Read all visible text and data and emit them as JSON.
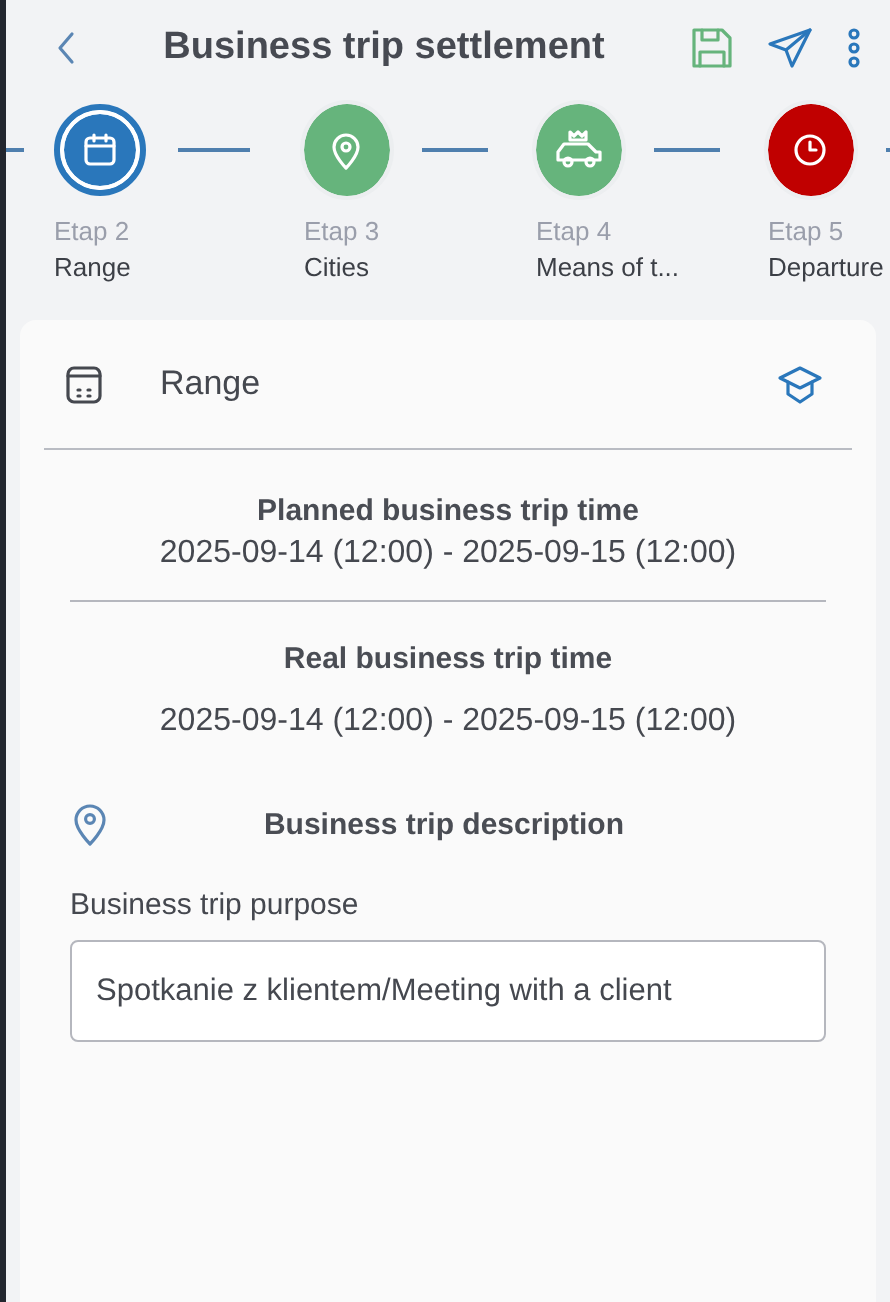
{
  "header": {
    "title": "Business trip settlement"
  },
  "steps": [
    {
      "kind": "calendar",
      "stage": "Etap 2",
      "label": "Range",
      "color": "#2a77bb",
      "selected": true
    },
    {
      "kind": "pin",
      "stage": "Etap 3",
      "label": "Cities",
      "color": "#66b47c",
      "selected": false
    },
    {
      "kind": "car",
      "stage": "Etap 4",
      "label": "Means of t...",
      "color": "#66b47c",
      "selected": false
    },
    {
      "kind": "clock",
      "stage": "Etap 5",
      "label": "Departure",
      "color": "#c00000",
      "selected": false
    }
  ],
  "section": {
    "title": "Range"
  },
  "periods": [
    {
      "title": "Planned business trip time",
      "value": "2025-09-14 (12:00) - 2025-09-15 (12:00)"
    },
    {
      "title": "Real business trip time",
      "value": "2025-09-14 (12:00) - 2025-09-15 (12:00)"
    }
  ],
  "description": {
    "title": "Business trip description",
    "field_label": "Business trip purpose",
    "value": "Spotkanie z klientem/Meeting with a client"
  }
}
